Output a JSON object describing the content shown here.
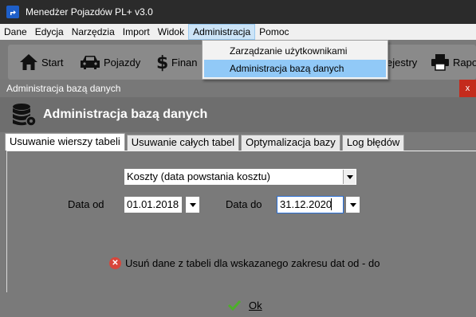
{
  "window": {
    "title": "Menedżer Pojazdów PL+   v3.0"
  },
  "menu": {
    "items": [
      "Dane",
      "Edycja",
      "Narzędzia",
      "Import",
      "Widok",
      "Administracja",
      "Pomoc"
    ],
    "active": "Administracja"
  },
  "toolbar": {
    "start": "Start",
    "vehicles": "Pojazdy",
    "finance": "Finan",
    "registers": "ejestry",
    "reports": "Rapo"
  },
  "dropdown": {
    "items": [
      "Zarządzanie użytkownikami",
      "Administracja bazą danych"
    ],
    "highlighted": "Administracja bazą danych"
  },
  "dialog": {
    "title": "Administracja bazą danych",
    "close": "x",
    "header": "Administracja bazą danych",
    "tabs": [
      "Usuwanie wierszy tabeli",
      "Usuwanie całych tabel",
      "Optymalizacja bazy",
      "Log błędów"
    ],
    "active_tab": "Usuwanie wierszy tabeli",
    "table_select": {
      "value": "Koszty (data powstania kosztu)"
    },
    "date_from": {
      "label": "Data od",
      "value": "01.01.2018"
    },
    "date_to": {
      "label": "Data do",
      "value": "31.12.2020"
    },
    "info_text": "Usuń dane z tabeli dla wskazanego zakresu dat od - do",
    "ok_label": "Ok"
  },
  "colors": {
    "accent": "#91c9f7",
    "close": "#c42b1c",
    "ok_check": "#4caf2a",
    "error_icon": "#d8463b"
  }
}
